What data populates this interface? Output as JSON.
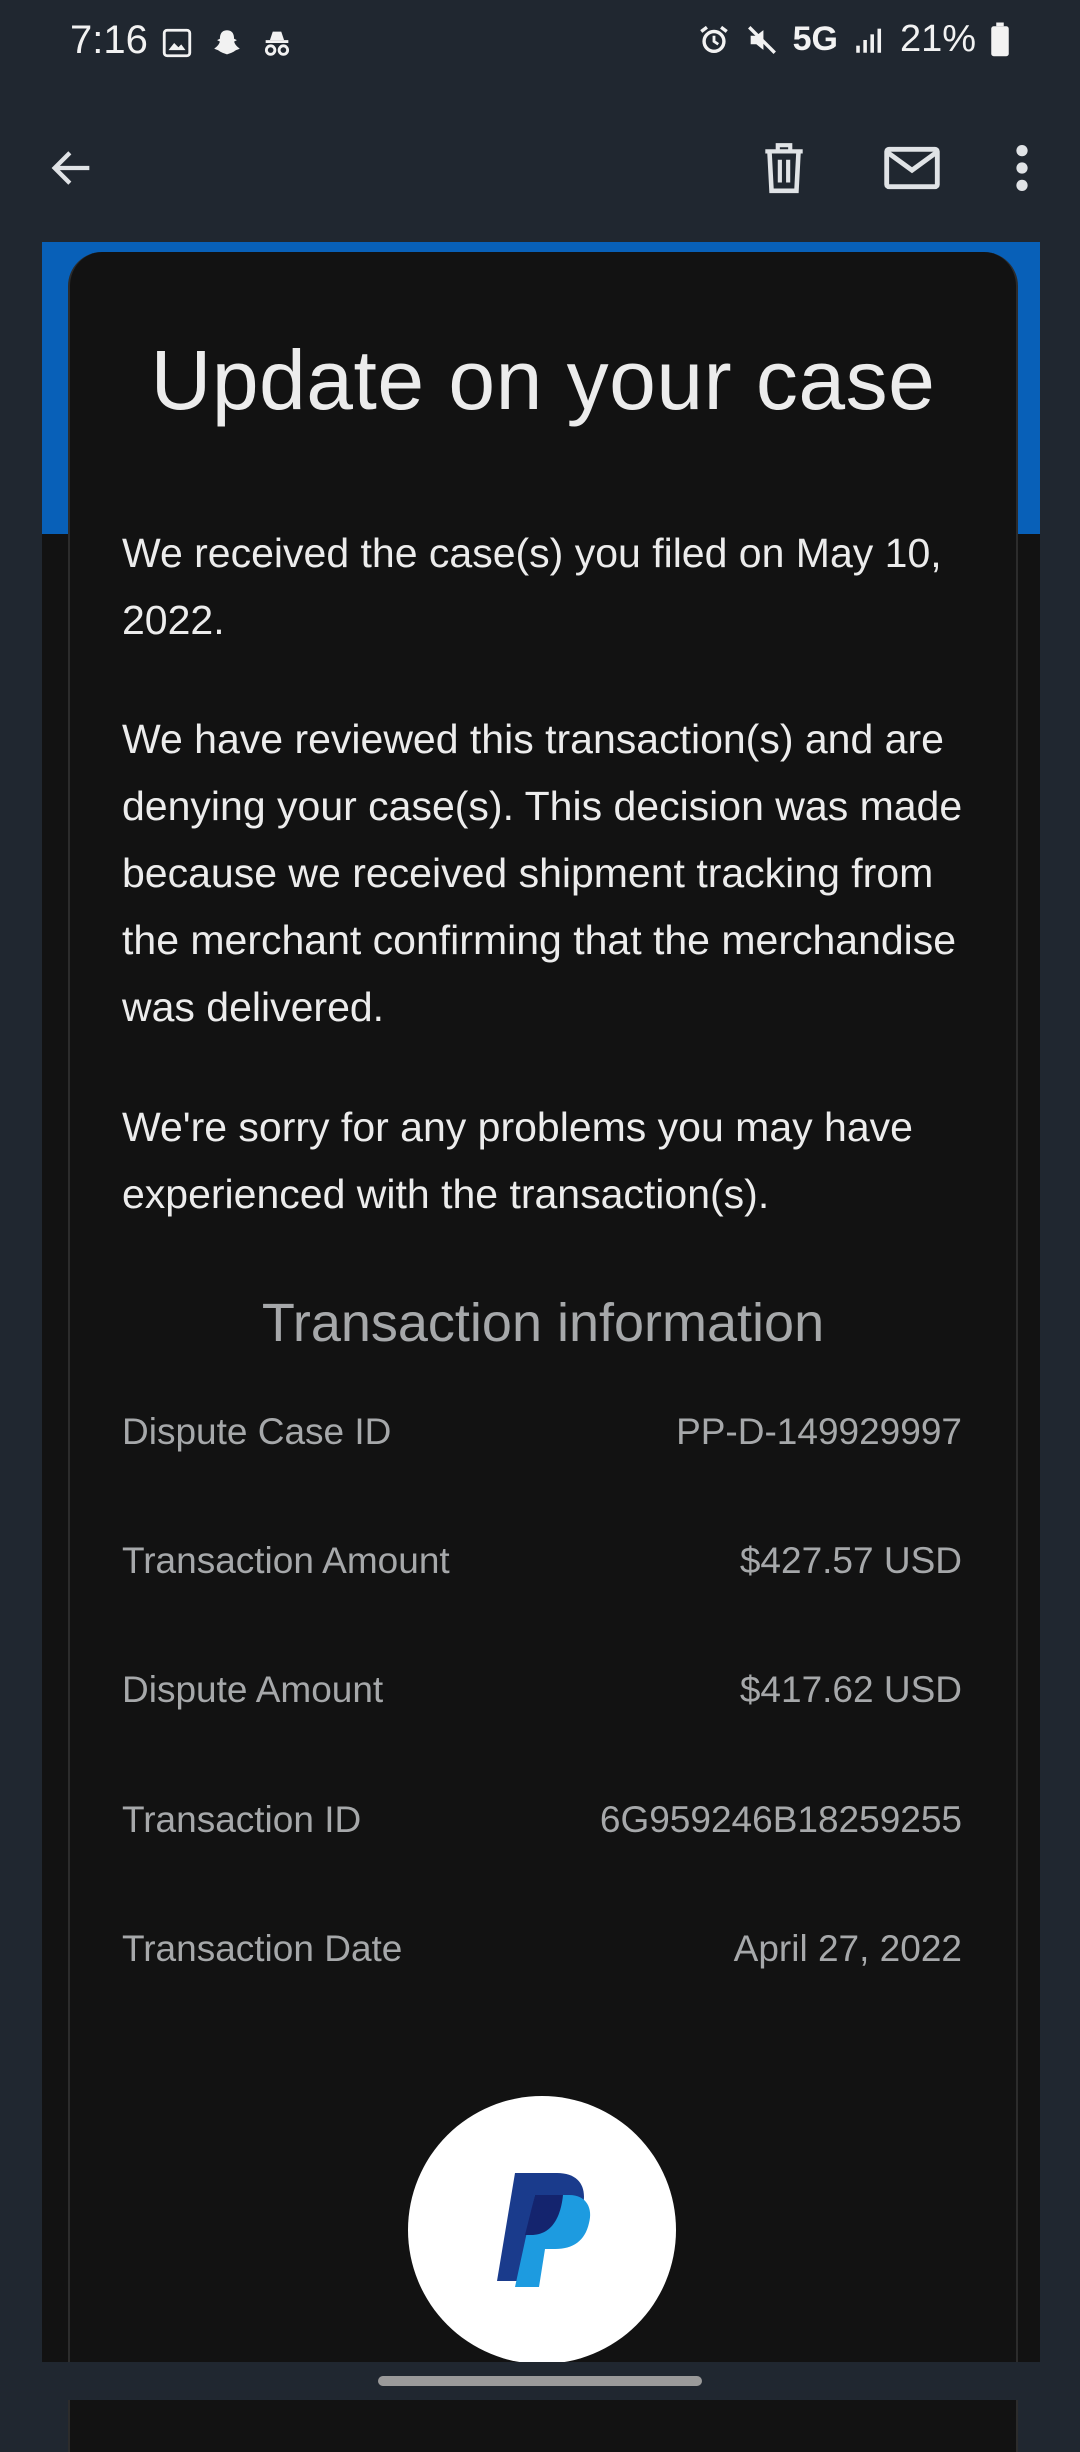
{
  "status_bar": {
    "time": "7:16",
    "network": "5G",
    "battery": "21%"
  },
  "app_bar": {
    "back_icon": "arrow-left-icon",
    "delete_icon": "trash-icon",
    "mark_unread_icon": "mail-icon",
    "more_icon": "more-vertical-icon"
  },
  "email": {
    "headline": "Update on your case",
    "paragraphs": [
      "We received the case(s) you filed on May 10, 2022.",
      "We have reviewed this transaction(s) and are denying your case(s). This decision was made because we received shipment tracking from the merchant confirming that the merchandise was delivered.",
      "We're sorry for any problems you may have experienced with the transaction(s)."
    ],
    "transaction_heading": "Transaction information",
    "rows": [
      {
        "label": "Dispute Case ID",
        "value": "PP-D-149929997"
      },
      {
        "label": "Transaction Amount",
        "value": "$427.57 USD"
      },
      {
        "label": "Dispute Amount",
        "value": "$417.62 USD"
      },
      {
        "label": "Transaction ID",
        "value": "6G959246B18259255"
      },
      {
        "label": "Transaction Date",
        "value": "April 27, 2022"
      }
    ],
    "logo_icon": "paypal-logo"
  },
  "colors": {
    "background": "#202730",
    "email_background": "#121212",
    "header_band": "#0860b8",
    "primary_text": "#ececec",
    "secondary_text": "#a6a8aa"
  }
}
